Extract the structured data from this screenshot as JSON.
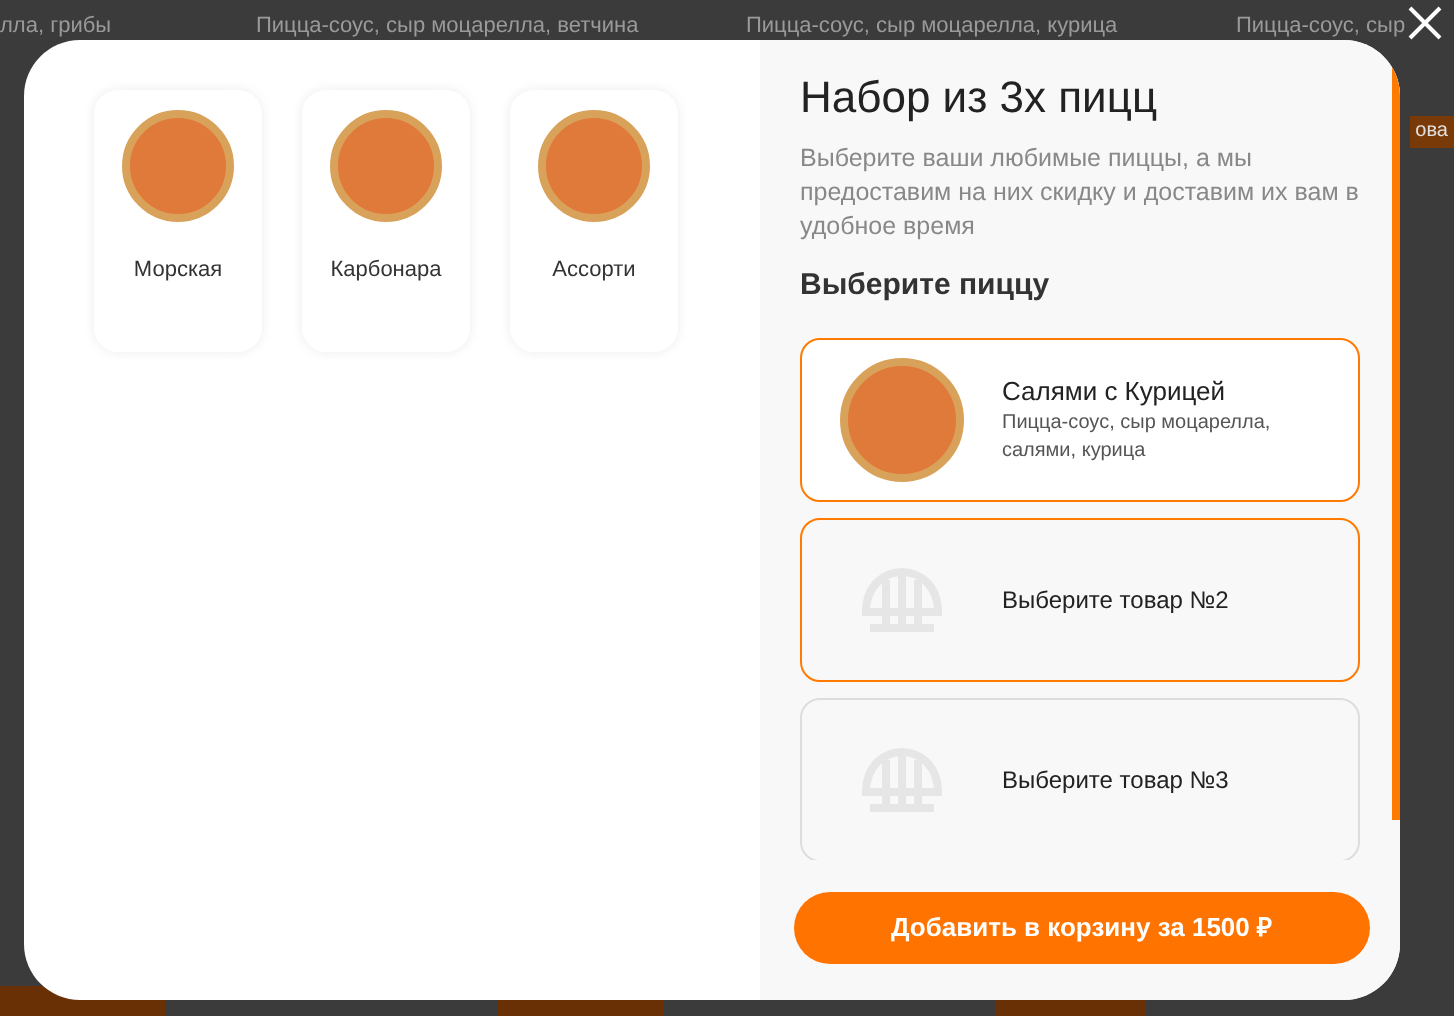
{
  "backdrop": {
    "top_texts": [
      "лла, грибы",
      "Пицца-соус, сыр моцарелла, ветчина",
      "Пицца-соус, сыр моцарелла, курица",
      "Пицца-соус, сыр"
    ],
    "side_button": "ова"
  },
  "pizzas": [
    {
      "name": "Морская"
    },
    {
      "name": "Карбонара"
    },
    {
      "name": "Ассорти"
    }
  ],
  "title": "Набор из 3х пицц",
  "description": "Выберите ваши любимые пиццы, а мы предоставим на них скидку и доставим их вам в удобное время",
  "section_title": "Выберите пиццу",
  "slots": [
    {
      "kind": "filled",
      "active": true,
      "name": "Салями с Курицей",
      "ingredients": "Пицца-соус, сыр моцарелла, салями, курица"
    },
    {
      "kind": "empty",
      "active": true,
      "name": "Выберите товар №2"
    },
    {
      "kind": "empty",
      "active": false,
      "name": "Выберите товар №3"
    }
  ],
  "add_button": "Добавить в корзину за 1500 ₽"
}
